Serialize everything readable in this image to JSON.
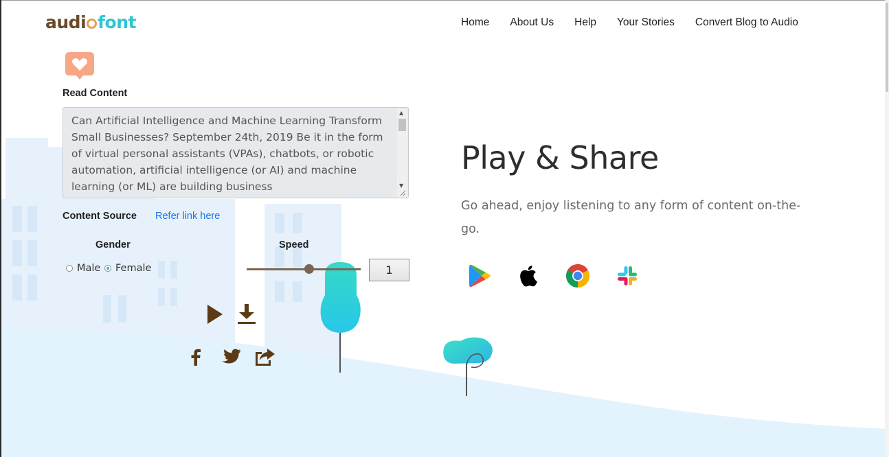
{
  "header": {
    "logo": {
      "part1": "audi",
      "part2": "font"
    },
    "nav": [
      {
        "label": "Home"
      },
      {
        "label": "About Us"
      },
      {
        "label": "Help"
      },
      {
        "label": "Your Stories"
      },
      {
        "label": "Convert Blog to Audio"
      }
    ]
  },
  "form": {
    "read_content_label": "Read Content",
    "content_text": "Can Artificial Intelligence and Machine Learning Transform Small Businesses? September 24th, 2019 Be it in the form of virtual personal assistants (VPAs), chatbots, or robotic automation, artificial intelligence (or AI) and machine learning (or ML) are building business",
    "content_source_label": "Content Source",
    "refer_link_label": "Refer link here",
    "gender_label": "Gender",
    "gender_options": [
      {
        "label": "Male",
        "checked": false
      },
      {
        "label": "Female",
        "checked": true
      }
    ],
    "speed_label": "Speed",
    "speed_value": "1",
    "speed_slider_fraction": 0.55
  },
  "hero": {
    "title": "Play & Share",
    "subtitle": "Go ahead, enjoy listening to any form of content on-the-go."
  },
  "icons": {
    "badge": "heart-chat-icon",
    "play": "play-icon",
    "download": "download-icon",
    "facebook": "facebook-icon",
    "twitter": "twitter-icon",
    "share": "share-icon",
    "stores": [
      "google-play-icon",
      "apple-icon",
      "chrome-icon",
      "slack-icon"
    ]
  },
  "colors": {
    "brand_brown": "#6b4a2b",
    "brand_cyan": "#2fc6d1",
    "link_blue": "#1a73e8",
    "sky_light": "#e3f3fd"
  }
}
